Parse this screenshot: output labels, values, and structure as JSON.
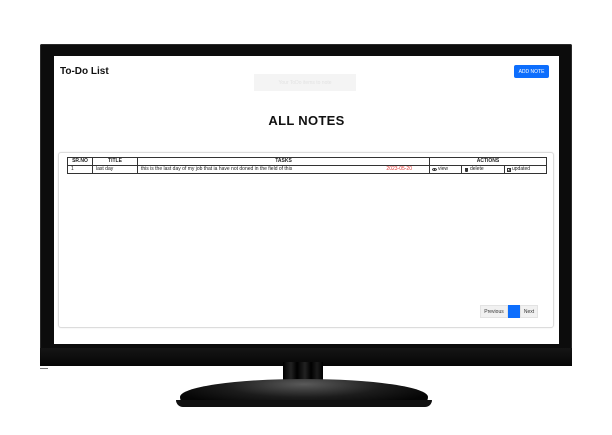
{
  "app": {
    "title": "To-Do List"
  },
  "header": {
    "faint_text": "Your ToDo items to note",
    "add_button": "ADD NOTE"
  },
  "main": {
    "heading": "ALL NOTES"
  },
  "table": {
    "headers": {
      "srno": "SR.NO",
      "title": "TITLE",
      "tasks": "TASKS",
      "actions": "ACTIONS"
    },
    "rows": [
      {
        "srno": "1",
        "title": "last day",
        "task": "this is the last day of my job that ia have not doned in the field of this",
        "date": "2023-05-20",
        "actions": {
          "view": "view",
          "delete": "delete",
          "update": "updated"
        }
      }
    ]
  },
  "pagination": {
    "previous": "Previous",
    "current": "1",
    "next": "Next"
  },
  "colors": {
    "accent": "#0d6efd",
    "date_text": "#e0332f"
  }
}
